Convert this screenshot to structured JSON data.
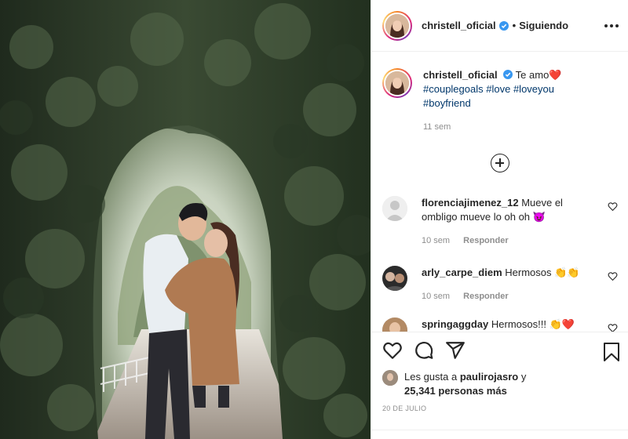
{
  "colors": {
    "text": "#262626",
    "secondary": "#8e8e8e",
    "link": "#00376b",
    "verified": "#3897f0",
    "heart": "#ed4956",
    "border": "#efefef"
  },
  "photo": {
    "alt_subject": "couple kissing under a tree arch"
  },
  "header": {
    "username": "christell_oficial",
    "separator": "•",
    "follow_status": "Siguiendo",
    "more_icon": "more-horizontal-icon"
  },
  "caption": {
    "username": "christell_oficial",
    "text": "Te amo",
    "emoji": "❤️",
    "hashtags": [
      "#couplegoals",
      "#love",
      "#loveyou",
      "#boyfriend"
    ],
    "time": "11 sem"
  },
  "comments": [
    {
      "username": "florenciajimenez_12",
      "text": "Mueve el ombligo mueve lo oh oh 😈",
      "time": "10 sem",
      "reply": "Responder"
    },
    {
      "username": "arly_carpe_diem",
      "text": "Hermosos 👏👏",
      "time": "10 sem",
      "reply": "Responder"
    },
    {
      "username": "springaggday",
      "text": "Hermosos!!! 👏❤️",
      "time": "",
      "reply": ""
    }
  ],
  "likes": {
    "prefix": "Les gusta a",
    "first_user": "paulirojasro",
    "connector": "y",
    "others": "25,341 personas más"
  },
  "date": "20 DE JULIO",
  "icons": [
    "heart-icon",
    "comment-icon",
    "share-icon",
    "bookmark-icon",
    "load-more-icon"
  ]
}
